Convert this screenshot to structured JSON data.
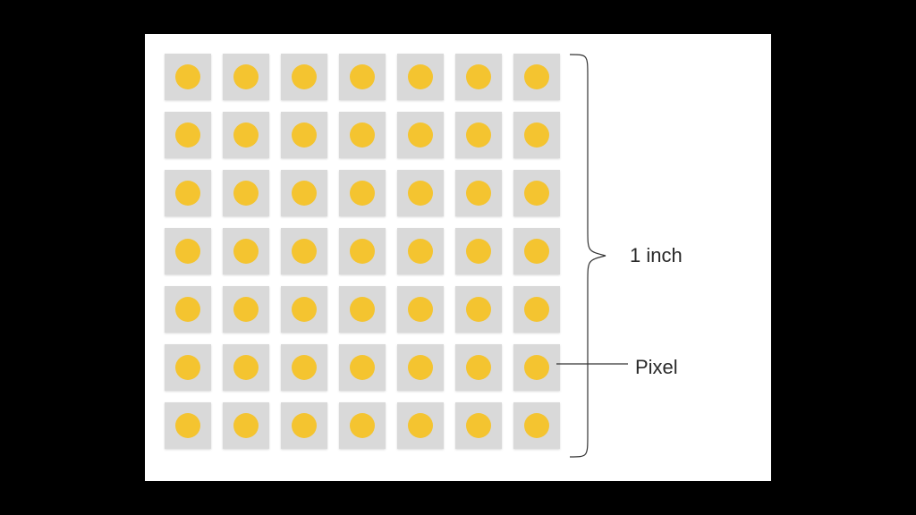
{
  "diagram": {
    "grid_rows": 7,
    "grid_cols": 7,
    "colors": {
      "pixel_tile": "#d9d9d9",
      "pixel_dot": "#f4c430",
      "background": "#000000",
      "canvas": "#ffffff",
      "stroke": "#333333"
    },
    "labels": {
      "height": "1 inch",
      "single_pixel": "Pixel"
    }
  }
}
